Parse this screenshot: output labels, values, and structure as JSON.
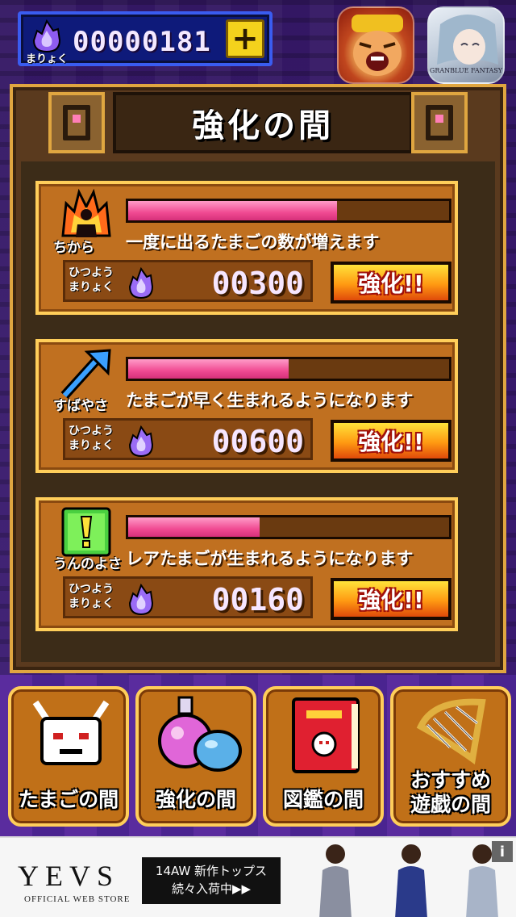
{
  "header": {
    "mp_label": "まりょく",
    "mp_value": "00000181",
    "add_label": "+"
  },
  "app_icons": {
    "gbf_text": "GRANBLUE FANTASY"
  },
  "panel": {
    "title": "強化の間"
  },
  "upgrades": [
    {
      "stat": "ちから",
      "icon": "fire-silhouette-icon",
      "description": "一度に出るたまごの数が増えます",
      "progress": 0.65,
      "cost_label": "ひつよう\nまりょく",
      "cost": "00300",
      "button": "強化!!"
    },
    {
      "stat": "すばやさ",
      "icon": "arrow-icon",
      "description": "たまごが早く生まれるようになります",
      "progress": 0.5,
      "cost_label": "ひつよう\nまりょく",
      "cost": "00600",
      "button": "強化!!"
    },
    {
      "stat": "うんのよさ",
      "icon": "exclamation-icon",
      "description": "レアたまごが生まれるようになります",
      "progress": 0.41,
      "cost_label": "ひつよう\nまりょく",
      "cost": "00160",
      "button": "強化!!"
    }
  ],
  "nav": [
    {
      "label": "たまごの間",
      "icon": "monster-icon"
    },
    {
      "label": "強化の間",
      "icon": "potion-icon"
    },
    {
      "label": "図鑑の間",
      "icon": "book-icon"
    },
    {
      "label": "おすすめ\n遊戯の間",
      "icon": "harp-icon"
    }
  ],
  "ad": {
    "brand": "YEVS",
    "brand_sub": "OFFICIAL WEB STORE",
    "promo_line1": "14AW 新作トップス",
    "promo_line2": "続々入荷中▶▶",
    "info": "i"
  },
  "colors": {
    "bar_fill": "#f04a92",
    "card": "#c07020",
    "button": "#ff9a12"
  }
}
